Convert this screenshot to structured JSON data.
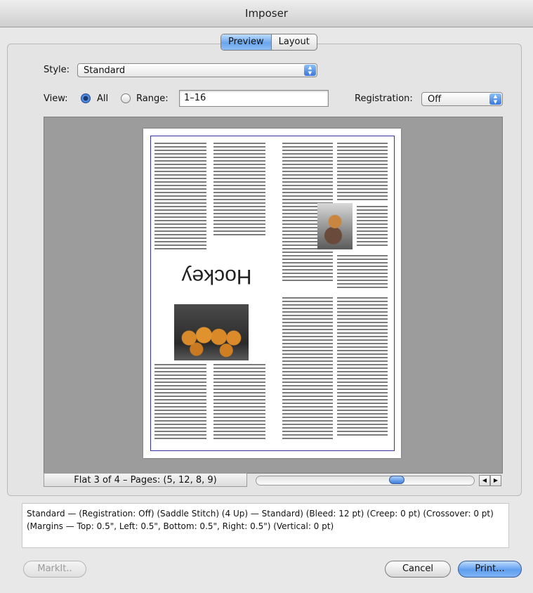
{
  "window": {
    "title": "Imposer"
  },
  "tabs": [
    {
      "label": "Preview",
      "active": true
    },
    {
      "label": "Layout",
      "active": false
    }
  ],
  "style": {
    "label": "Style:",
    "value": "Standard"
  },
  "view": {
    "label": "View:",
    "all_label": "All",
    "all_selected": true,
    "range_label": "Range:",
    "range_value": "1–16"
  },
  "registration": {
    "label": "Registration:",
    "value": "Off"
  },
  "preview": {
    "heading_text": "Hockey",
    "status": "Flat 3 of 4 – Pages: (5, 12, 8, 9)",
    "scroll_position": 0.66
  },
  "summary": {
    "text": "Standard — (Registration: Off) (Saddle Stitch) (4 Up) — Standard) (Bleed: 12 pt) (Creep: 0 pt) (Crossover: 0 pt) (Margins — Top: 0.5\", Left: 0.5\", Bottom: 0.5\", Right: 0.5\") (Vertical: 0 pt)"
  },
  "buttons": {
    "markit": "MarkIt..",
    "cancel": "Cancel",
    "print": "Print..."
  },
  "colors": {
    "accent": "#5f9ef0",
    "preview_bg": "#9c9c9c",
    "sheet_border": "#3333aa"
  }
}
